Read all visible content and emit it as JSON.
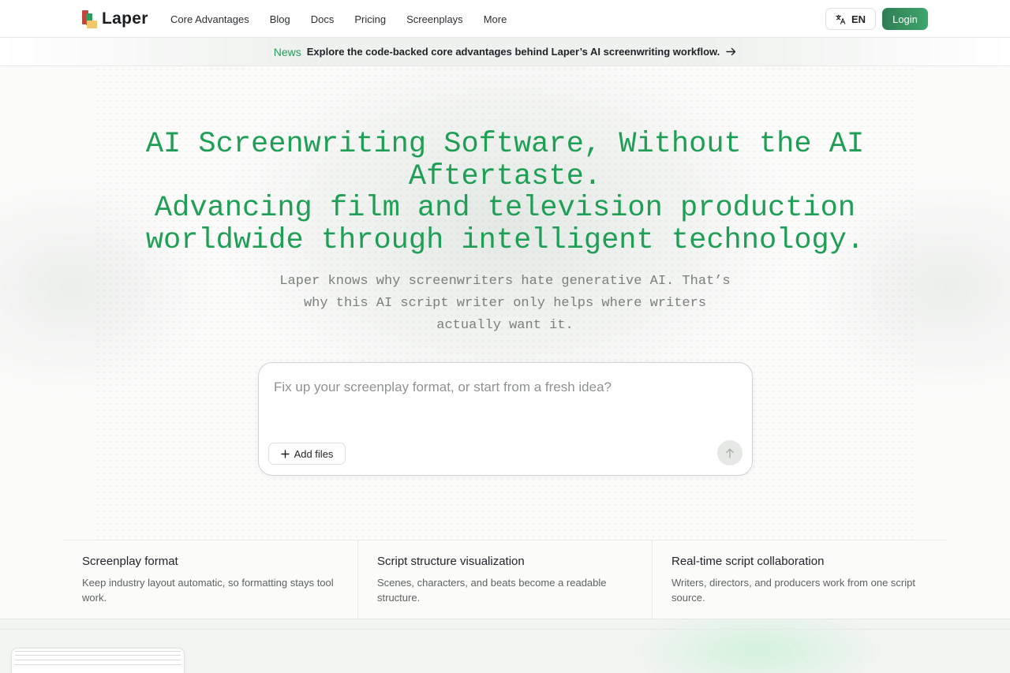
{
  "brand": {
    "name": "Laper"
  },
  "nav": {
    "items": [
      {
        "label": "Core Advantages"
      },
      {
        "label": "Blog"
      },
      {
        "label": "Docs"
      },
      {
        "label": "Pricing"
      },
      {
        "label": "Screenplays"
      },
      {
        "label": "More"
      }
    ]
  },
  "header": {
    "language": {
      "label": "EN",
      "icon": "translate-icon"
    },
    "login_label": "Login"
  },
  "news": {
    "tag": "News",
    "text": "Explore the code-backed core advantages behind Laper’s AI screenwriting workflow.",
    "icon": "arrow-right-icon"
  },
  "hero": {
    "title_lines": [
      "AI Screenwriting Software, Without the AI",
      "Aftertaste.",
      "Advancing film and television production",
      "worldwide through intelligent technology."
    ],
    "subtitle_lines": [
      "Laper knows why screenwriters hate generative AI. That’s",
      "why this AI script writer only helps where writers",
      "actually want it."
    ]
  },
  "composer": {
    "placeholder": "Fix up your screenplay format, or start from a fresh idea?",
    "value": "",
    "add_files_label": "Add files",
    "add_icon": "plus-icon",
    "send_icon": "arrow-up-icon"
  },
  "features": [
    {
      "title": "Screenplay format",
      "description": "Keep industry layout automatic, so formatting stays tool work."
    },
    {
      "title": "Script structure visualization",
      "description": "Scenes, characters, and beats become a readable structure."
    },
    {
      "title": "Real-time script collaboration",
      "description": "Writers, directors, and producers work from one script source."
    }
  ],
  "colors": {
    "accent": "#1f9e55",
    "login_bg": "#3a9a64",
    "news_tag": "#22a05a",
    "subtitle": "#7b807d"
  }
}
